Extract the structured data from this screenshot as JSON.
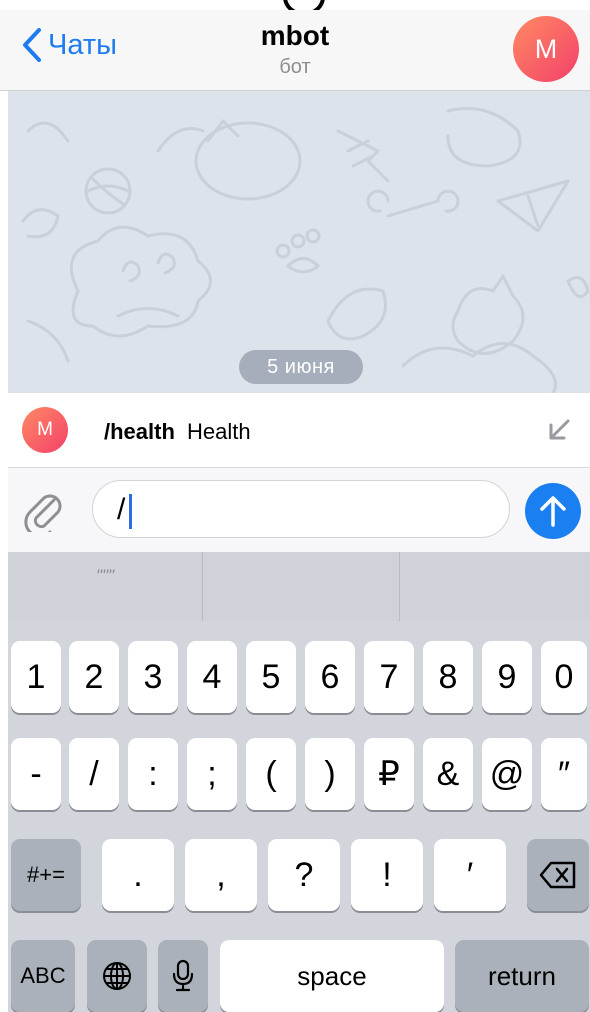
{
  "header": {
    "back_label": "Чаты",
    "title": "mbot",
    "subtitle": "бот",
    "avatar_letter": "M"
  },
  "chat": {
    "date_label": "5 июня"
  },
  "suggestion": {
    "avatar_letter": "M",
    "command": "/health",
    "description": "Health"
  },
  "input": {
    "value": "/"
  },
  "predictive": {
    "items": [
      "\"\"\"",
      "",
      ""
    ]
  },
  "keyboard": {
    "row1": [
      "1",
      "2",
      "3",
      "4",
      "5",
      "6",
      "7",
      "8",
      "9",
      "0"
    ],
    "row2": [
      "-",
      "/",
      ":",
      ";",
      "(",
      ")",
      "₽",
      "&",
      "@",
      "″"
    ],
    "row3_mode": "#+=",
    "row3": [
      ".",
      ",",
      "?",
      "!",
      "′"
    ],
    "row4_abc": "ABC",
    "row4_space": "space",
    "row4_return": "return"
  },
  "colors": {
    "accent": "#1e7cf2",
    "send": "#1a7ff0",
    "chat_bg": "#dde3ea",
    "avatar_gradient_start": "#ff8a63",
    "avatar_gradient_end": "#f3406a"
  },
  "icons": [
    "chevron-left-icon",
    "paperclip-icon",
    "arrow-up-icon",
    "collapse-arrow-icon",
    "globe-icon",
    "microphone-icon",
    "delete-icon"
  ]
}
